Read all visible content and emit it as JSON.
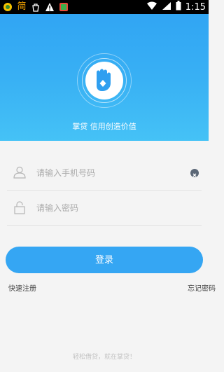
{
  "status_bar": {
    "carrier_char": "简",
    "time": "1:15"
  },
  "hero": {
    "tagline": "掌贷 信用创造价值"
  },
  "form": {
    "phone_placeholder": "请输入手机号码",
    "password_placeholder": "请输入密码"
  },
  "actions": {
    "login_label": "登录",
    "register_label": "快速注册",
    "forgot_label": "忘记密码"
  },
  "footer": {
    "slogan": "轻松借贷，就在掌贷！"
  },
  "colors": {
    "accent": "#35a6f3",
    "hero_gradient_top": "#31a5f3",
    "hero_gradient_bottom": "#45c2f6"
  }
}
